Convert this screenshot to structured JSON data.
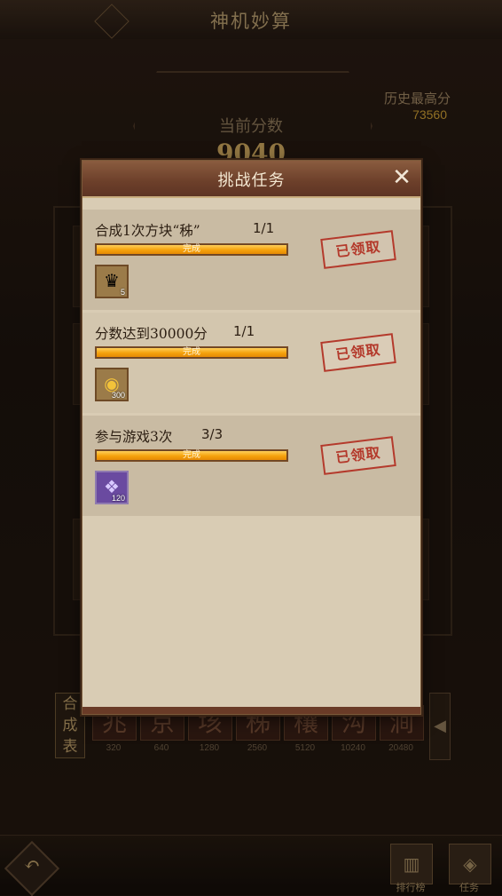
{
  "background": {
    "title": "神机妙算",
    "current_score_label": "当前分数",
    "current_score_value": "9040",
    "history_best_label": "历史最高分",
    "history_best_value": "73560",
    "recipe_label": "合成表",
    "recipe_tiles": [
      {
        "char": "兆",
        "value": "320"
      },
      {
        "char": "京",
        "value": "640"
      },
      {
        "char": "垓",
        "value": "1280"
      },
      {
        "char": "秭",
        "value": "2560"
      },
      {
        "char": "穰",
        "value": "5120"
      },
      {
        "char": "沟",
        "value": "10240"
      },
      {
        "char": "涧",
        "value": "20480"
      }
    ],
    "nav": {
      "ranking_label": "排行榜",
      "tasks_label": "任务"
    }
  },
  "modal": {
    "title": "挑战任务",
    "close_icon": "close-icon",
    "tasks": [
      {
        "title": "合成1次方块“秭”",
        "progress_text": "1/1",
        "progress": 1.0,
        "bar_text": "完成",
        "status": "已领取",
        "reward_icon": "gold-ingot-pile-icon",
        "reward_count": "5"
      },
      {
        "title": "分数达到30000分",
        "progress_text": "1/1",
        "progress": 1.0,
        "bar_text": "完成",
        "status": "已领取",
        "reward_icon": "gold-ingot-icon",
        "reward_count": "300"
      },
      {
        "title": "参与游戏3次",
        "progress_text": "3/3",
        "progress": 1.0,
        "bar_text": "完成",
        "status": "已领取",
        "reward_icon": "purple-crystal-icon",
        "reward_count": "120"
      }
    ]
  },
  "colors": {
    "modal_bg": "#d9ccb4",
    "header": "#6c3f2a",
    "progress_fill": "#f5a20c",
    "stamp": "#b43a2c"
  }
}
